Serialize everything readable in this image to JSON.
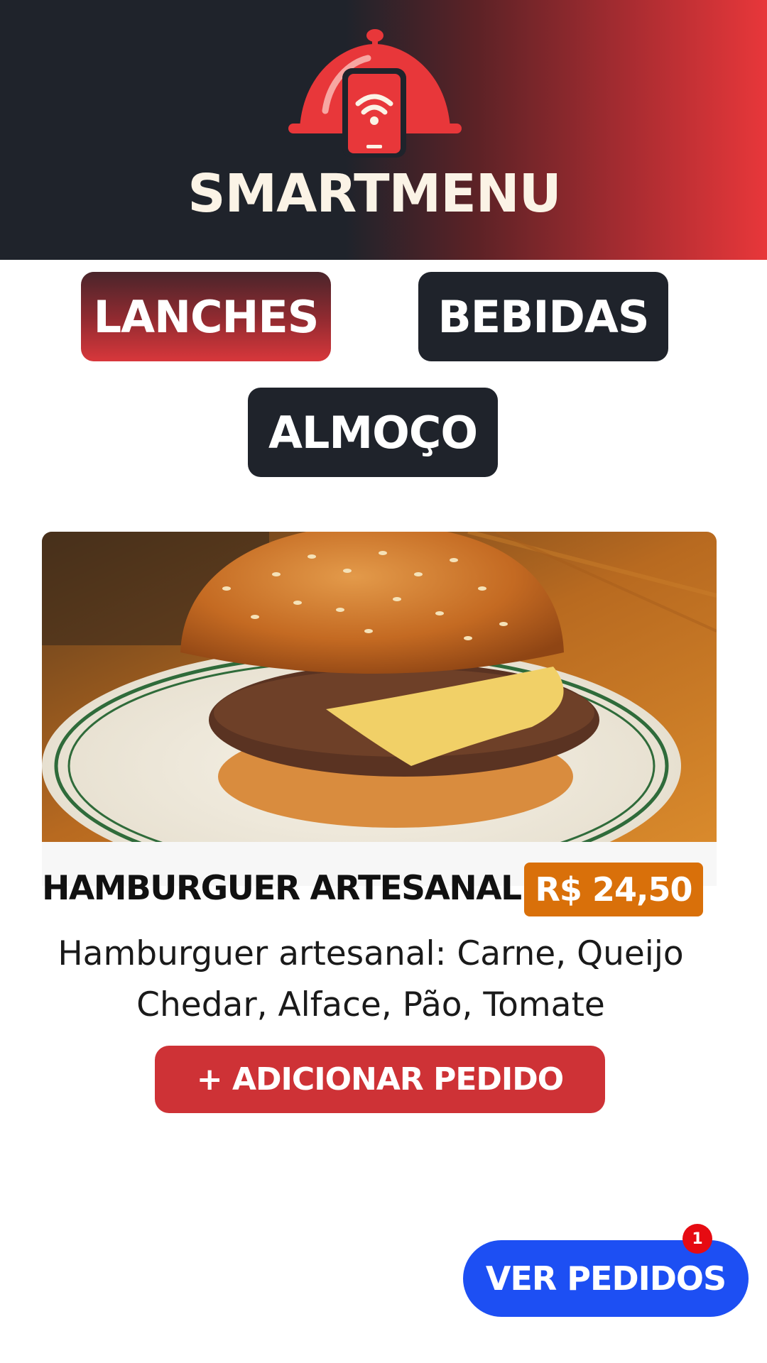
{
  "header": {
    "brand": "SMARTMENU",
    "logo_icon": "cloche-phone-wifi-icon"
  },
  "categories": [
    {
      "label": "LANCHES",
      "active": true
    },
    {
      "label": "BEBIDAS",
      "active": false
    },
    {
      "label": "ALMOÇO",
      "active": false
    }
  ],
  "item": {
    "image_icon": "burger-photo",
    "name": "HAMBURGUER ARTESANAL",
    "price": "R$ 24,50",
    "description": "Hamburguer artesanal: Carne, Queijo Chedar, Alface, Pão, Tomate",
    "add_label": "+ ADICIONAR PEDIDO"
  },
  "orders": {
    "label": "VER PEDIDOS",
    "count": "1"
  },
  "colors": {
    "header_dark": "#1f232b",
    "header_red": "#e8373a",
    "price_orange": "#d9700a",
    "add_red": "#ce3236",
    "orders_blue": "#1d4ff3",
    "badge_red": "#e60b12"
  }
}
